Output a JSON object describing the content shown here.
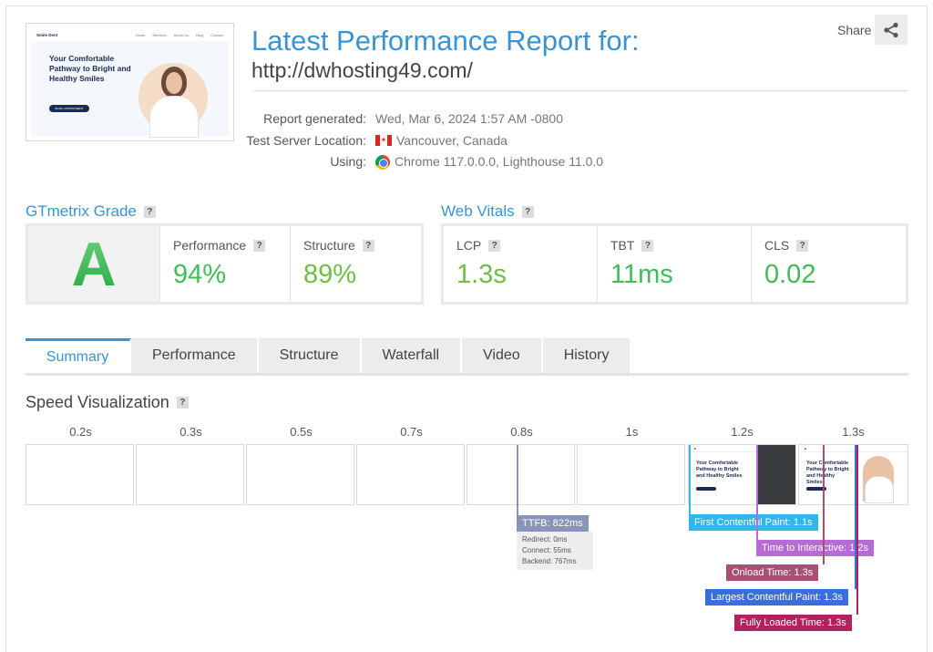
{
  "header": {
    "title": "Latest Performance Report for:",
    "url": "http://dwhosting49.com/",
    "share_label": "Share"
  },
  "thumbnail": {
    "logo": "Smile Dent",
    "nav": [
      "Home",
      "Services",
      "About Us",
      "Blog",
      "Contact"
    ],
    "headline": "Your Comfortable Pathway to Bright and Healthy Smiles",
    "cta": "BOOK APPOINTMENT"
  },
  "meta": {
    "report_generated_label": "Report generated:",
    "report_generated_value": "Wed, Mar 6, 2024 1:57 AM -0800",
    "server_label": "Test Server Location:",
    "server_value": "Vancouver, Canada",
    "using_label": "Using:",
    "using_value": "Chrome 117.0.0.0, Lighthouse 11.0.0"
  },
  "grade": {
    "heading": "GTmetrix Grade",
    "letter": "A",
    "performance_label": "Performance",
    "performance_value": "94%",
    "structure_label": "Structure",
    "structure_value": "89%"
  },
  "vitals": {
    "heading": "Web Vitals",
    "lcp_label": "LCP",
    "lcp_value": "1.3s",
    "tbt_label": "TBT",
    "tbt_value": "11ms",
    "cls_label": "CLS",
    "cls_value": "0.02"
  },
  "tabs": [
    "Summary",
    "Performance",
    "Structure",
    "Waterfall",
    "Video",
    "History"
  ],
  "speed": {
    "heading": "Speed Visualization",
    "times": [
      "0.2s",
      "0.3s",
      "0.5s",
      "0.7s",
      "0.8s",
      "1s",
      "1.2s",
      "1.3s"
    ],
    "ttfb": "TTFB: 822ms",
    "redirect": "Redirect: 0ms",
    "connect": "Connect: 55ms",
    "backend": "Backend: 767ms",
    "fcp": "First Contentful Paint: 1.1s",
    "tti": "Time to Interactive: 1.2s",
    "onload": "Onload Time: 1.3s",
    "lcp": "Largest Contentful Paint: 1.3s",
    "fully_loaded": "Fully Loaded Time: 1.3s"
  },
  "colors": {
    "accent": "#3b93d4",
    "grade_green": "#3ebd5a",
    "ttfb": "#8a94b8",
    "fcp": "#2db7ee",
    "tti": "#b76bd4",
    "onload": "#a84f74",
    "lcp": "#3a6fdb",
    "fully_loaded": "#b0235e"
  }
}
